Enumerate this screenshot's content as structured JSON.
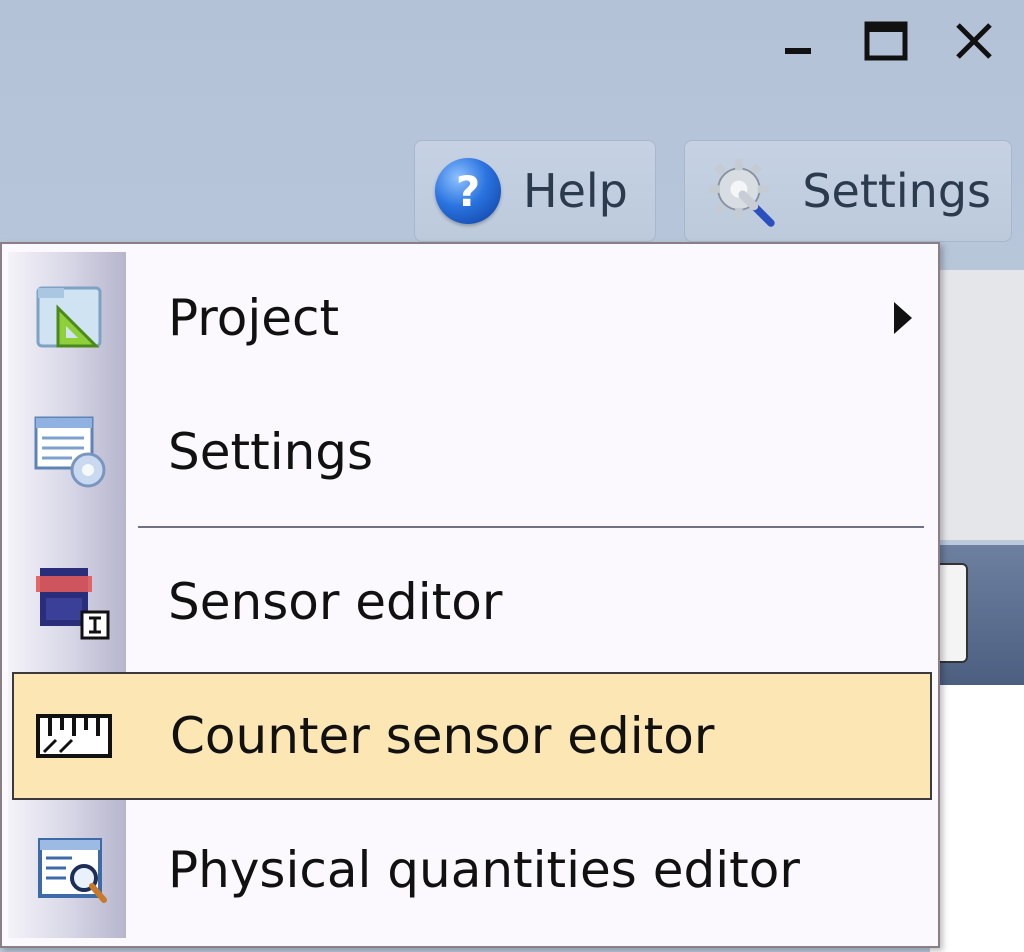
{
  "window": {
    "controls": {
      "minimize": "minimize",
      "maximize": "maximize",
      "close": "close"
    }
  },
  "toolbar": {
    "help_label": "Help",
    "settings_label": "Settings"
  },
  "menu": {
    "items": [
      {
        "label": "Project",
        "icon": "project-folder-icon",
        "has_submenu": true
      },
      {
        "label": "Settings",
        "icon": "settings-list-icon",
        "has_submenu": false
      },
      {
        "label": "Sensor editor",
        "icon": "sensor-editor-icon",
        "has_submenu": false
      },
      {
        "label": "Counter sensor editor",
        "icon": "counter-ruler-icon",
        "has_submenu": false,
        "highlighted": true
      },
      {
        "label": "Physical quantities editor",
        "icon": "magnifier-document-icon",
        "has_submenu": false
      }
    ]
  },
  "colors": {
    "titlebar": "#b8c6da",
    "menu_bg": "#fbf9fe",
    "highlight": "#fce6b4",
    "help_blue": "#2b74e0"
  }
}
